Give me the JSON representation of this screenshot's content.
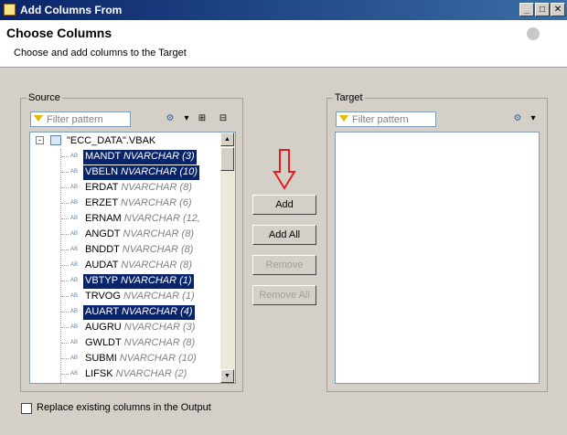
{
  "window": {
    "title": "Add Columns From",
    "controls": [
      "_",
      "□",
      "✕"
    ]
  },
  "header": {
    "title": "Choose Columns",
    "subtitle": "Choose and add columns to the Target"
  },
  "source": {
    "label": "Source",
    "filter_placeholder": "Filter pattern",
    "root": "\"ECC_DATA\".VBAK",
    "columns": [
      {
        "name": "MANDT",
        "type": "NVARCHAR (3)",
        "selected": true
      },
      {
        "name": "VBELN",
        "type": "NVARCHAR (10)",
        "selected": true
      },
      {
        "name": "ERDAT",
        "type": "NVARCHAR (8)",
        "selected": false
      },
      {
        "name": "ERZET",
        "type": "NVARCHAR (6)",
        "selected": false
      },
      {
        "name": "ERNAM",
        "type": "NVARCHAR (12,",
        "selected": false
      },
      {
        "name": "ANGDT",
        "type": "NVARCHAR (8)",
        "selected": false
      },
      {
        "name": "BNDDT",
        "type": "NVARCHAR (8)",
        "selected": false
      },
      {
        "name": "AUDAT",
        "type": "NVARCHAR (8)",
        "selected": false
      },
      {
        "name": "VBTYP",
        "type": "NVARCHAR (1)",
        "selected": true
      },
      {
        "name": "TRVOG",
        "type": "NVARCHAR (1)",
        "selected": false
      },
      {
        "name": "AUART",
        "type": "NVARCHAR (4)",
        "selected": true
      },
      {
        "name": "AUGRU",
        "type": "NVARCHAR (3)",
        "selected": false
      },
      {
        "name": "GWLDT",
        "type": "NVARCHAR (8)",
        "selected": false
      },
      {
        "name": "SUBMI",
        "type": "NVARCHAR (10)",
        "selected": false
      },
      {
        "name": "LIFSK",
        "type": "NVARCHAR (2)",
        "selected": false
      }
    ]
  },
  "target": {
    "label": "Target",
    "filter_placeholder": "Filter pattern"
  },
  "buttons": {
    "add": "Add",
    "add_all": "Add All",
    "remove": "Remove",
    "remove_all": "Remove All"
  },
  "option": {
    "label": "Replace existing columns in the Output",
    "checked": false
  },
  "colors": {
    "selection": "#0a246a",
    "arrow": "#e02020"
  }
}
